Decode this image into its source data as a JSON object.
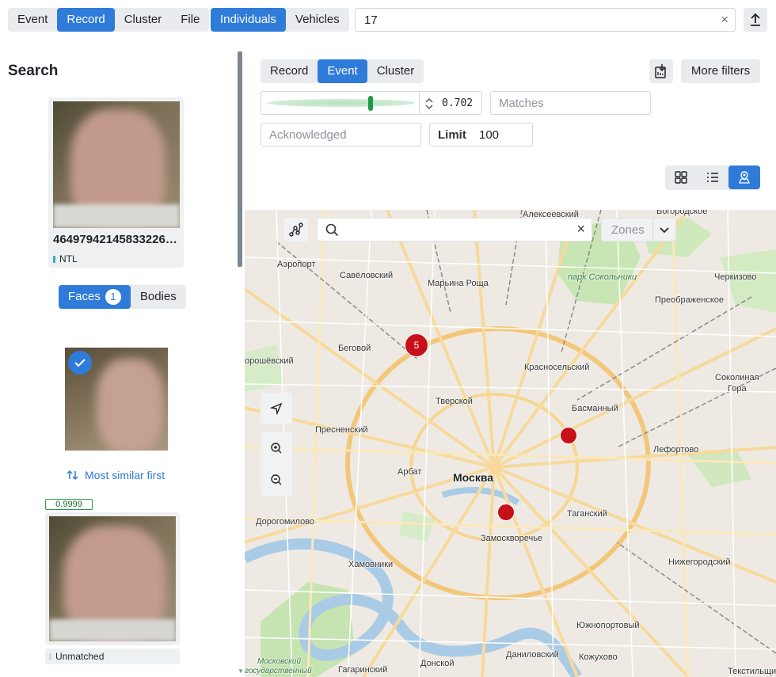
{
  "top": {
    "type_tabs": [
      "Event",
      "Record",
      "Cluster",
      "File"
    ],
    "type_active": "Record",
    "object_tabs": [
      "Individuals",
      "Vehicles"
    ],
    "object_active": "Individuals",
    "search_value": "17",
    "clear_label": "×"
  },
  "left": {
    "title": "Search",
    "card_id": "464979421458332262...",
    "card_id_display": "46497942145833226…",
    "card_tag": "NTL",
    "faces_label": "Faces",
    "faces_count": "1",
    "bodies_label": "Bodies",
    "sort_label": "Most similar first",
    "score": "0.9999",
    "result_status": "Unmatched"
  },
  "right": {
    "view_tabs": [
      "Record",
      "Event",
      "Cluster"
    ],
    "view_active": "Event",
    "more_filters": "More filters",
    "threshold": "0.702",
    "threshold_fraction": 0.7,
    "matches_placeholder": "Matches",
    "ack_placeholder": "Acknowledged",
    "limit_label": "Limit",
    "limit_value": "100"
  },
  "map": {
    "search_placeholder": "",
    "zones_label": "Zones",
    "cluster_count": "5",
    "labels": {
      "aleks": "Алексеевский",
      "bogor": "Богородское",
      "aeroport": "Аэропорт",
      "savel": "Савёловский",
      "marina": "Марьина Роща",
      "park": "парк Сокольники",
      "cherk": "Черкизово",
      "preob": "Преображенское",
      "begov": "Беговой",
      "khor": "орошёвский",
      "krasn": "Красносельский",
      "sokol": "Соколиная",
      "gora": "Гора",
      "tver": "Тверской",
      "basm": "Басманный",
      "presn": "Пресненский",
      "lefort": "Лефортово",
      "arbat": "Арбат",
      "moskva": "Москва",
      "dorog": "Дорогомилово",
      "tagan": "Таганский",
      "zamosk": "Замоскворечье",
      "khamov": "Хамовники",
      "nizheg": "Нижегородский",
      "yuzhno": "Южнопортовый",
      "donsk": "Донской",
      "danil": "Даниловский",
      "kozh": "Кожухово",
      "tekst": "Текстильщики",
      "gagar": "Гагаринский",
      "mosk1": "Московский",
      "mosk2": "государственный"
    }
  },
  "colors": {
    "accent": "#2f7bd9",
    "marker": "#c8101a",
    "score_border": "#2a9a4a"
  }
}
